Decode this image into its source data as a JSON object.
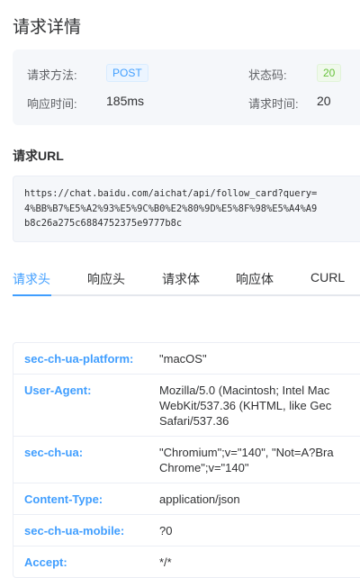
{
  "title": "请求详情",
  "info": {
    "method_label": "请求方法:",
    "method": "POST",
    "status_label": "状态码:",
    "status": "20",
    "duration_label": "响应时间:",
    "duration": "185ms",
    "time_label": "请求时间:",
    "time": "20"
  },
  "url": {
    "heading": "请求URL",
    "lines": [
      "https://chat.baidu.com/aichat/api/follow_card?query=",
      "4%BB%B7%E5%A2%93%E5%9C%B0%E2%80%9D%E5%8F%98%E5%A4%A9",
      "b8c26a275c6884752375e9777b8c"
    ]
  },
  "tabs": [
    "请求头",
    "响应头",
    "请求体",
    "响应体",
    "CURL"
  ],
  "headers": [
    {
      "key": "sec-ch-ua-platform:",
      "value": "\"macOS\""
    },
    {
      "key": "User-Agent:",
      "value": "Mozilla/5.0 (Macintosh; Intel Mac\nWebKit/537.36 (KHTML, like Gec\nSafari/537.36"
    },
    {
      "key": "sec-ch-ua:",
      "value": "\"Chromium\";v=\"140\", \"Not=A?Bra\nChrome\";v=\"140\""
    },
    {
      "key": "Content-Type:",
      "value": "application/json"
    },
    {
      "key": "sec-ch-ua-mobile:",
      "value": "?0"
    },
    {
      "key": "Accept:",
      "value": "*/*"
    }
  ]
}
